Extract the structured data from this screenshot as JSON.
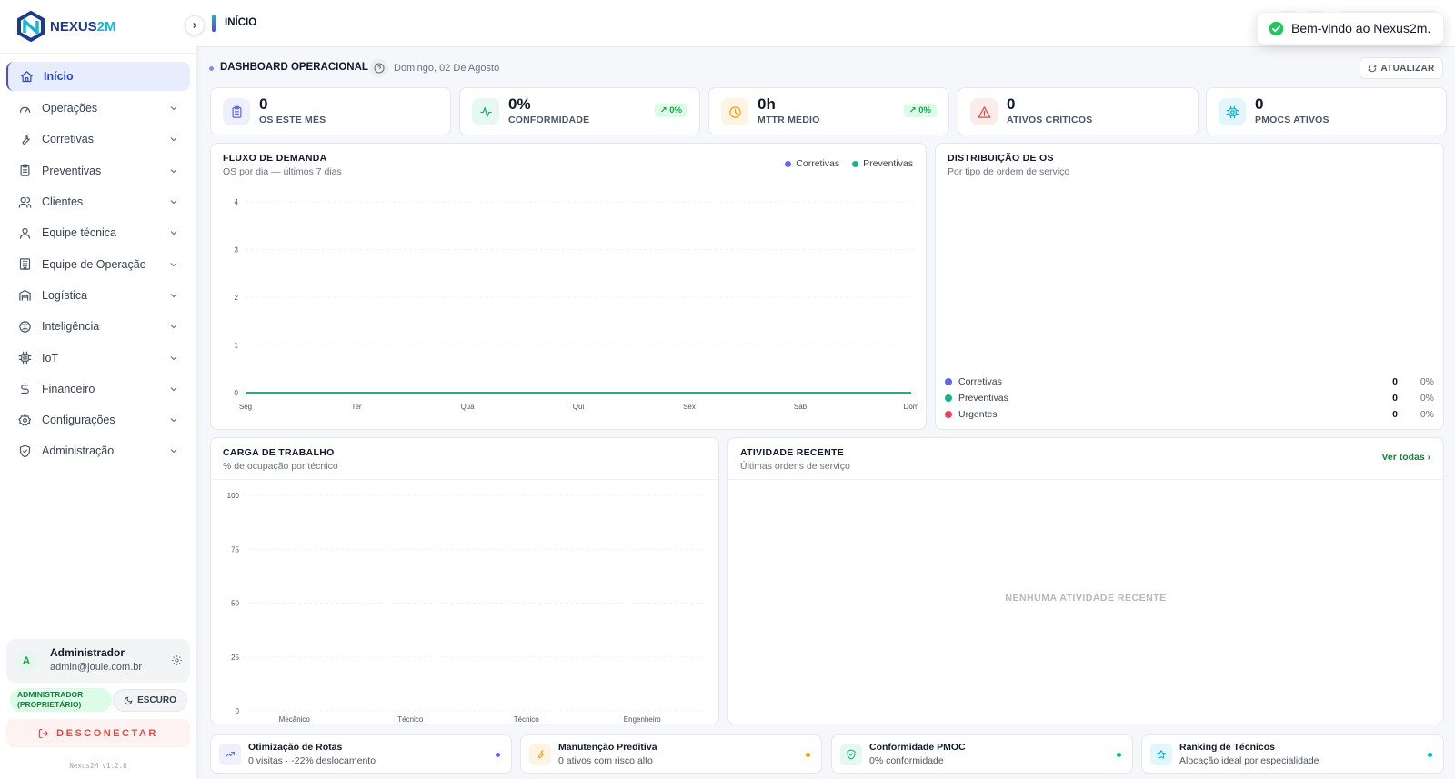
{
  "brand": {
    "name_part1": "NEXUS",
    "name_part2": "2M"
  },
  "topbar": {
    "breadcrumb": "INÍCIO"
  },
  "toast": {
    "message": "Bem-vindo ao Nexus2m."
  },
  "sidebar": {
    "items": [
      {
        "label": "Início",
        "icon": "home-icon",
        "active": true
      },
      {
        "label": "Operações",
        "icon": "gauge-icon"
      },
      {
        "label": "Corretivas",
        "icon": "wrench-icon"
      },
      {
        "label": "Preventivas",
        "icon": "clipboard-icon"
      },
      {
        "label": "Clientes",
        "icon": "users-icon"
      },
      {
        "label": "Equipe técnica",
        "icon": "user-icon"
      },
      {
        "label": "Equipe de Operação",
        "icon": "building-icon"
      },
      {
        "label": "Logística",
        "icon": "warehouse-icon"
      },
      {
        "label": "Inteligência",
        "icon": "brain-icon"
      },
      {
        "label": "IoT",
        "icon": "chip-icon"
      },
      {
        "label": "Financeiro",
        "icon": "dollar-icon"
      },
      {
        "label": "Configurações",
        "icon": "gear-icon"
      },
      {
        "label": "Administração",
        "icon": "shield-icon"
      }
    ],
    "user": {
      "initial": "A",
      "name": "Administrador",
      "email": "admin@joule.com.br"
    },
    "role": "ADMINISTRADOR (PROPRIETÁRIO)",
    "theme_label": "ESCURO",
    "logout_label": "DESCONECTAR",
    "version": "Nexus2M v1.2.8"
  },
  "dashboard": {
    "title": "DASHBOARD OPERACIONAL",
    "date": "Domingo, 02 De Agosto",
    "refresh_label": "ATUALIZAR"
  },
  "kpis": [
    {
      "value": "0",
      "label": "OS ESTE MÊS",
      "icon": "clipboard-icon",
      "color": "#6366f1",
      "bg": "#eef0fd"
    },
    {
      "value": "0%",
      "label": "CONFORMIDADE",
      "icon": "activity-icon",
      "color": "#10b981",
      "bg": "#e7f8f1",
      "badge": "↗ 0%"
    },
    {
      "value": "0h",
      "label": "MTTR MÉDIO",
      "icon": "clock-icon",
      "color": "#f59e0b",
      "bg": "#fef4e4",
      "badge": "↗ 0%"
    },
    {
      "value": "0",
      "label": "ATIVOS CRÍTICOS",
      "icon": "alert-triangle-icon",
      "color": "#ef4444",
      "bg": "#fdecec"
    },
    {
      "value": "0",
      "label": "PMOCS ATIVOS",
      "icon": "cpu-icon",
      "color": "#06b6d4",
      "bg": "#e2f7fb"
    }
  ],
  "demand": {
    "title": "FLUXO DE DEMANDA",
    "subtitle": "OS por dia — últimos 7 dias",
    "legend": [
      "Corretivas",
      "Preventivas"
    ]
  },
  "distribution": {
    "title": "DISTRIBUIÇÃO DE OS",
    "subtitle": "Por tipo de ordem de serviço",
    "rows": [
      {
        "label": "Corretivas",
        "count": "0",
        "pct": "0%",
        "color": "#6366f1"
      },
      {
        "label": "Preventivas",
        "count": "0",
        "pct": "0%",
        "color": "#10b981"
      },
      {
        "label": "Urgentes",
        "count": "0",
        "pct": "0%",
        "color": "#f43f5e"
      }
    ]
  },
  "workload": {
    "title": "CARGA DE TRABALHO",
    "subtitle": "% de ocupação por técnico"
  },
  "activity": {
    "title": "ATIVIDADE RECENTE",
    "subtitle": "Últimas ordens de serviço",
    "view_all": "Ver todas",
    "empty": "NENHUMA ATIVIDADE RECENTE"
  },
  "insights": [
    {
      "title": "Otimização de Rotas",
      "subtitle": "0 visitas · -22% deslocamento",
      "icon": "trending-icon",
      "color": "#6366f1",
      "bg": "#eef0fd"
    },
    {
      "title": "Manutenção Preditiva",
      "subtitle": "0 ativos com risco alto",
      "icon": "wrench-icon",
      "color": "#f59e0b",
      "bg": "#fef4e4"
    },
    {
      "title": "Conformidade PMOC",
      "subtitle": "0% conformidade",
      "icon": "shield-check-icon",
      "color": "#10b981",
      "bg": "#e7f8f1"
    },
    {
      "title": "Ranking de Técnicos",
      "subtitle": "Alocação ideal por especialidade",
      "icon": "star-icon",
      "color": "#06b6d4",
      "bg": "#e2f7fb"
    }
  ],
  "chart_data": [
    {
      "type": "line",
      "title": "FLUXO DE DEMANDA",
      "x": [
        "Seg",
        "Ter",
        "Qua",
        "Qui",
        "Sex",
        "Sáb",
        "Dom"
      ],
      "series": [
        {
          "name": "Corretivas",
          "values": [
            0,
            0,
            0,
            0,
            0,
            0,
            0
          ],
          "color": "#6366f1"
        },
        {
          "name": "Preventivas",
          "values": [
            0,
            0,
            0,
            0,
            0,
            0,
            0
          ],
          "color": "#10b981"
        }
      ],
      "yticks": [
        0,
        1,
        2,
        3,
        4
      ],
      "ylim": [
        0,
        4
      ],
      "grid": true
    },
    {
      "type": "bar",
      "title": "CARGA DE TRABALHO",
      "categories": [
        "Mecânico",
        "Técnico",
        "Técnico",
        "Engenheiro"
      ],
      "values": [
        0,
        0,
        0,
        0
      ],
      "yticks": [
        0,
        25,
        50,
        75,
        100
      ],
      "ylim": [
        0,
        100
      ],
      "grid": true
    }
  ]
}
